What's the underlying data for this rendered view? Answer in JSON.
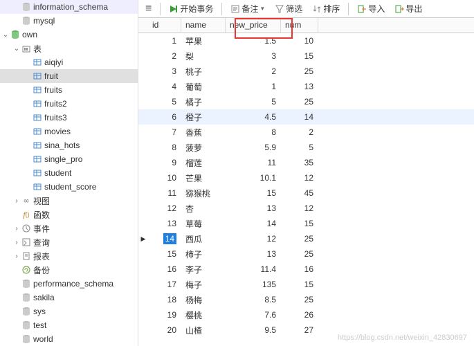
{
  "sidebar": {
    "items": [
      {
        "indent": 1,
        "exp": "",
        "icon": "db",
        "label": "information_schema"
      },
      {
        "indent": 1,
        "exp": "",
        "icon": "db",
        "label": "mysql"
      },
      {
        "indent": 0,
        "exp": "open",
        "icon": "db-green",
        "label": "own"
      },
      {
        "indent": 1,
        "exp": "open",
        "icon": "folder",
        "label": "表"
      },
      {
        "indent": 2,
        "exp": "",
        "icon": "table",
        "label": "aiqiyi"
      },
      {
        "indent": 2,
        "exp": "",
        "icon": "table",
        "label": "fruit",
        "selected": true
      },
      {
        "indent": 2,
        "exp": "",
        "icon": "table",
        "label": "fruits"
      },
      {
        "indent": 2,
        "exp": "",
        "icon": "table",
        "label": "fruits2"
      },
      {
        "indent": 2,
        "exp": "",
        "icon": "table",
        "label": "fruits3"
      },
      {
        "indent": 2,
        "exp": "",
        "icon": "table",
        "label": "movies"
      },
      {
        "indent": 2,
        "exp": "",
        "icon": "table",
        "label": "sina_hots"
      },
      {
        "indent": 2,
        "exp": "",
        "icon": "table",
        "label": "single_pro"
      },
      {
        "indent": 2,
        "exp": "",
        "icon": "table",
        "label": "student"
      },
      {
        "indent": 2,
        "exp": "",
        "icon": "table",
        "label": "student_score"
      },
      {
        "indent": 1,
        "exp": "closed",
        "icon": "view",
        "label": "视图"
      },
      {
        "indent": 1,
        "exp": "",
        "icon": "fx",
        "label": "函数"
      },
      {
        "indent": 1,
        "exp": "closed",
        "icon": "event",
        "label": "事件"
      },
      {
        "indent": 1,
        "exp": "closed",
        "icon": "query",
        "label": "查询"
      },
      {
        "indent": 1,
        "exp": "closed",
        "icon": "report",
        "label": "报表"
      },
      {
        "indent": 1,
        "exp": "",
        "icon": "backup",
        "label": "备份"
      },
      {
        "indent": 1,
        "exp": "",
        "icon": "db",
        "label": "performance_schema"
      },
      {
        "indent": 1,
        "exp": "",
        "icon": "db",
        "label": "sakila"
      },
      {
        "indent": 1,
        "exp": "",
        "icon": "db",
        "label": "sys"
      },
      {
        "indent": 1,
        "exp": "",
        "icon": "db",
        "label": "test"
      },
      {
        "indent": 1,
        "exp": "",
        "icon": "db",
        "label": "world"
      }
    ]
  },
  "toolbar": {
    "menu": "≡",
    "begin_tx": "开始事务",
    "memo": "备注",
    "filter": "筛选",
    "sort": "排序",
    "import": "导入",
    "export": "导出"
  },
  "grid": {
    "columns": {
      "id": "id",
      "name": "name",
      "price": "new_price",
      "num": "num"
    },
    "rows": [
      {
        "id": 1,
        "name": "苹果",
        "price": "1.5",
        "num": 10
      },
      {
        "id": 2,
        "name": "梨",
        "price": "3",
        "num": 15
      },
      {
        "id": 3,
        "name": "桃子",
        "price": "2",
        "num": 25
      },
      {
        "id": 4,
        "name": "葡萄",
        "price": "1",
        "num": 13
      },
      {
        "id": 5,
        "name": "橘子",
        "price": "5",
        "num": 25
      },
      {
        "id": 6,
        "name": "橙子",
        "price": "4.5",
        "num": 14,
        "hl": true
      },
      {
        "id": 7,
        "name": "香蕉",
        "price": "8",
        "num": 2
      },
      {
        "id": 8,
        "name": "菠萝",
        "price": "5.9",
        "num": 5
      },
      {
        "id": 9,
        "name": "榴莲",
        "price": "11",
        "num": 35
      },
      {
        "id": 10,
        "name": "芒果",
        "price": "10.1",
        "num": 12
      },
      {
        "id": 11,
        "name": "猕猴桃",
        "price": "15",
        "num": 45
      },
      {
        "id": 12,
        "name": "杏",
        "price": "13",
        "num": 12
      },
      {
        "id": 13,
        "name": "草莓",
        "price": "14",
        "num": 15
      },
      {
        "id": 14,
        "name": "西瓜",
        "price": "12",
        "num": 25,
        "active": true
      },
      {
        "id": 15,
        "name": "柿子",
        "price": "13",
        "num": 25
      },
      {
        "id": 16,
        "name": "李子",
        "price": "11.4",
        "num": 16
      },
      {
        "id": 17,
        "name": "梅子",
        "price": "135",
        "num": 15
      },
      {
        "id": 18,
        "name": "杨梅",
        "price": "8.5",
        "num": 25
      },
      {
        "id": 19,
        "name": "樱桃",
        "price": "7.6",
        "num": 26
      },
      {
        "id": 20,
        "name": "山楂",
        "price": "9.5",
        "num": 27
      }
    ]
  },
  "watermark": "https://blog.csdn.net/weixin_42830697"
}
